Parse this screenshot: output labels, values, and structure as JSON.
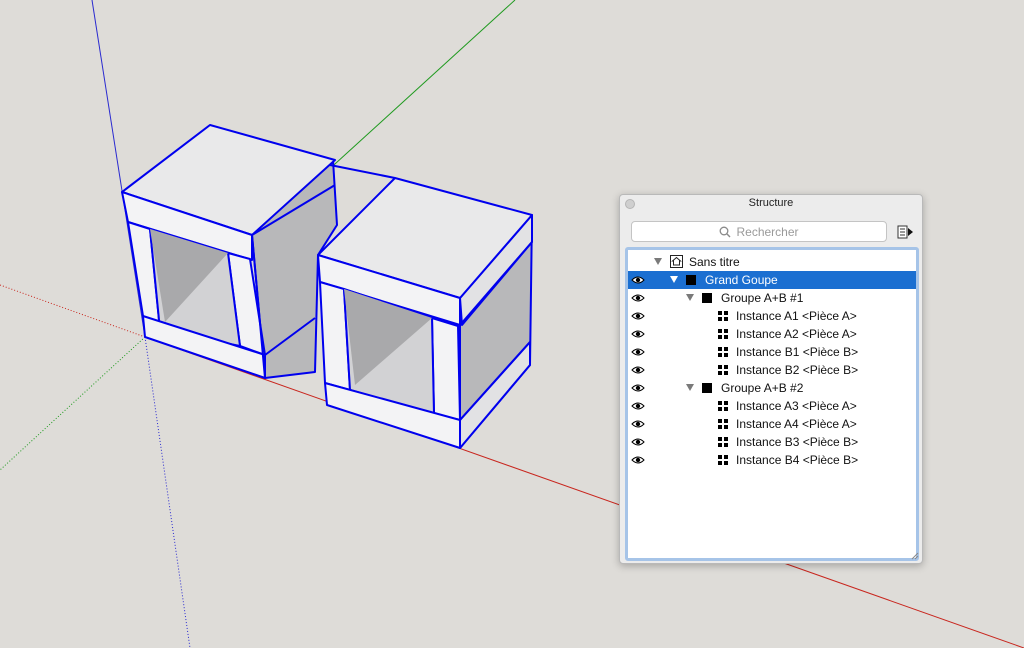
{
  "panel": {
    "title": "Structure",
    "search_placeholder": "Rechercher"
  },
  "tree": {
    "rows": [
      {
        "label": "Sans titre",
        "icon": "model-home-icon",
        "visible": false,
        "expanded": true,
        "selected": false
      },
      {
        "label": "Grand Goupe",
        "icon": "group-icon",
        "visible": true,
        "expanded": true,
        "selected": true
      },
      {
        "label": "Groupe A+B #1",
        "icon": "group-icon",
        "visible": true,
        "expanded": true,
        "selected": false
      },
      {
        "label": "Instance A1 <Pièce A>",
        "icon": "component-icon",
        "visible": true,
        "selected": false
      },
      {
        "label": "Instance A2 <Pièce A>",
        "icon": "component-icon",
        "visible": true,
        "selected": false
      },
      {
        "label": "Instance B1 <Pièce B>",
        "icon": "component-icon",
        "visible": true,
        "selected": false
      },
      {
        "label": "Instance B2 <Pièce B>",
        "icon": "component-icon",
        "visible": true,
        "selected": false
      },
      {
        "label": "Groupe A+B #2",
        "icon": "group-icon",
        "visible": true,
        "expanded": true,
        "selected": false
      },
      {
        "label": "Instance A3 <Pièce A>",
        "icon": "component-icon",
        "visible": true,
        "selected": false
      },
      {
        "label": "Instance A4 <Pièce A>",
        "icon": "component-icon",
        "visible": true,
        "selected": false
      },
      {
        "label": "Instance B3 <Pièce B>",
        "icon": "component-icon",
        "visible": true,
        "selected": false
      },
      {
        "label": "Instance B4 <Pièce B>",
        "icon": "component-icon",
        "visible": true,
        "selected": false
      }
    ]
  },
  "colors": {
    "background": "#dedcd8",
    "selection_edges": "#0000ee",
    "red_axis": "#c8261e",
    "green_axis": "#1f9a1f",
    "blue_axis": "#2a2ad0",
    "selected_row": "#1b6fd1"
  }
}
